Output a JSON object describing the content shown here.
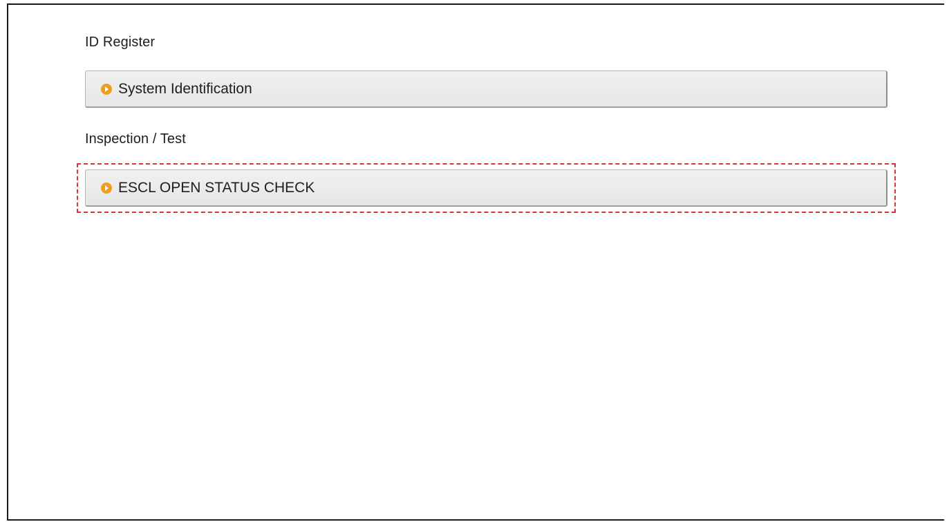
{
  "sections": {
    "id_register": {
      "heading": "ID Register",
      "button_label": "System Identification"
    },
    "inspection": {
      "heading": "Inspection / Test",
      "button_label": "ESCL OPEN STATUS CHECK"
    }
  },
  "icons": {
    "menu_bullet": "circle-arrow-right-icon"
  },
  "colors": {
    "bullet": "#f09d1a",
    "highlight": "#d9323a",
    "button_bg": "#ebebeb"
  }
}
